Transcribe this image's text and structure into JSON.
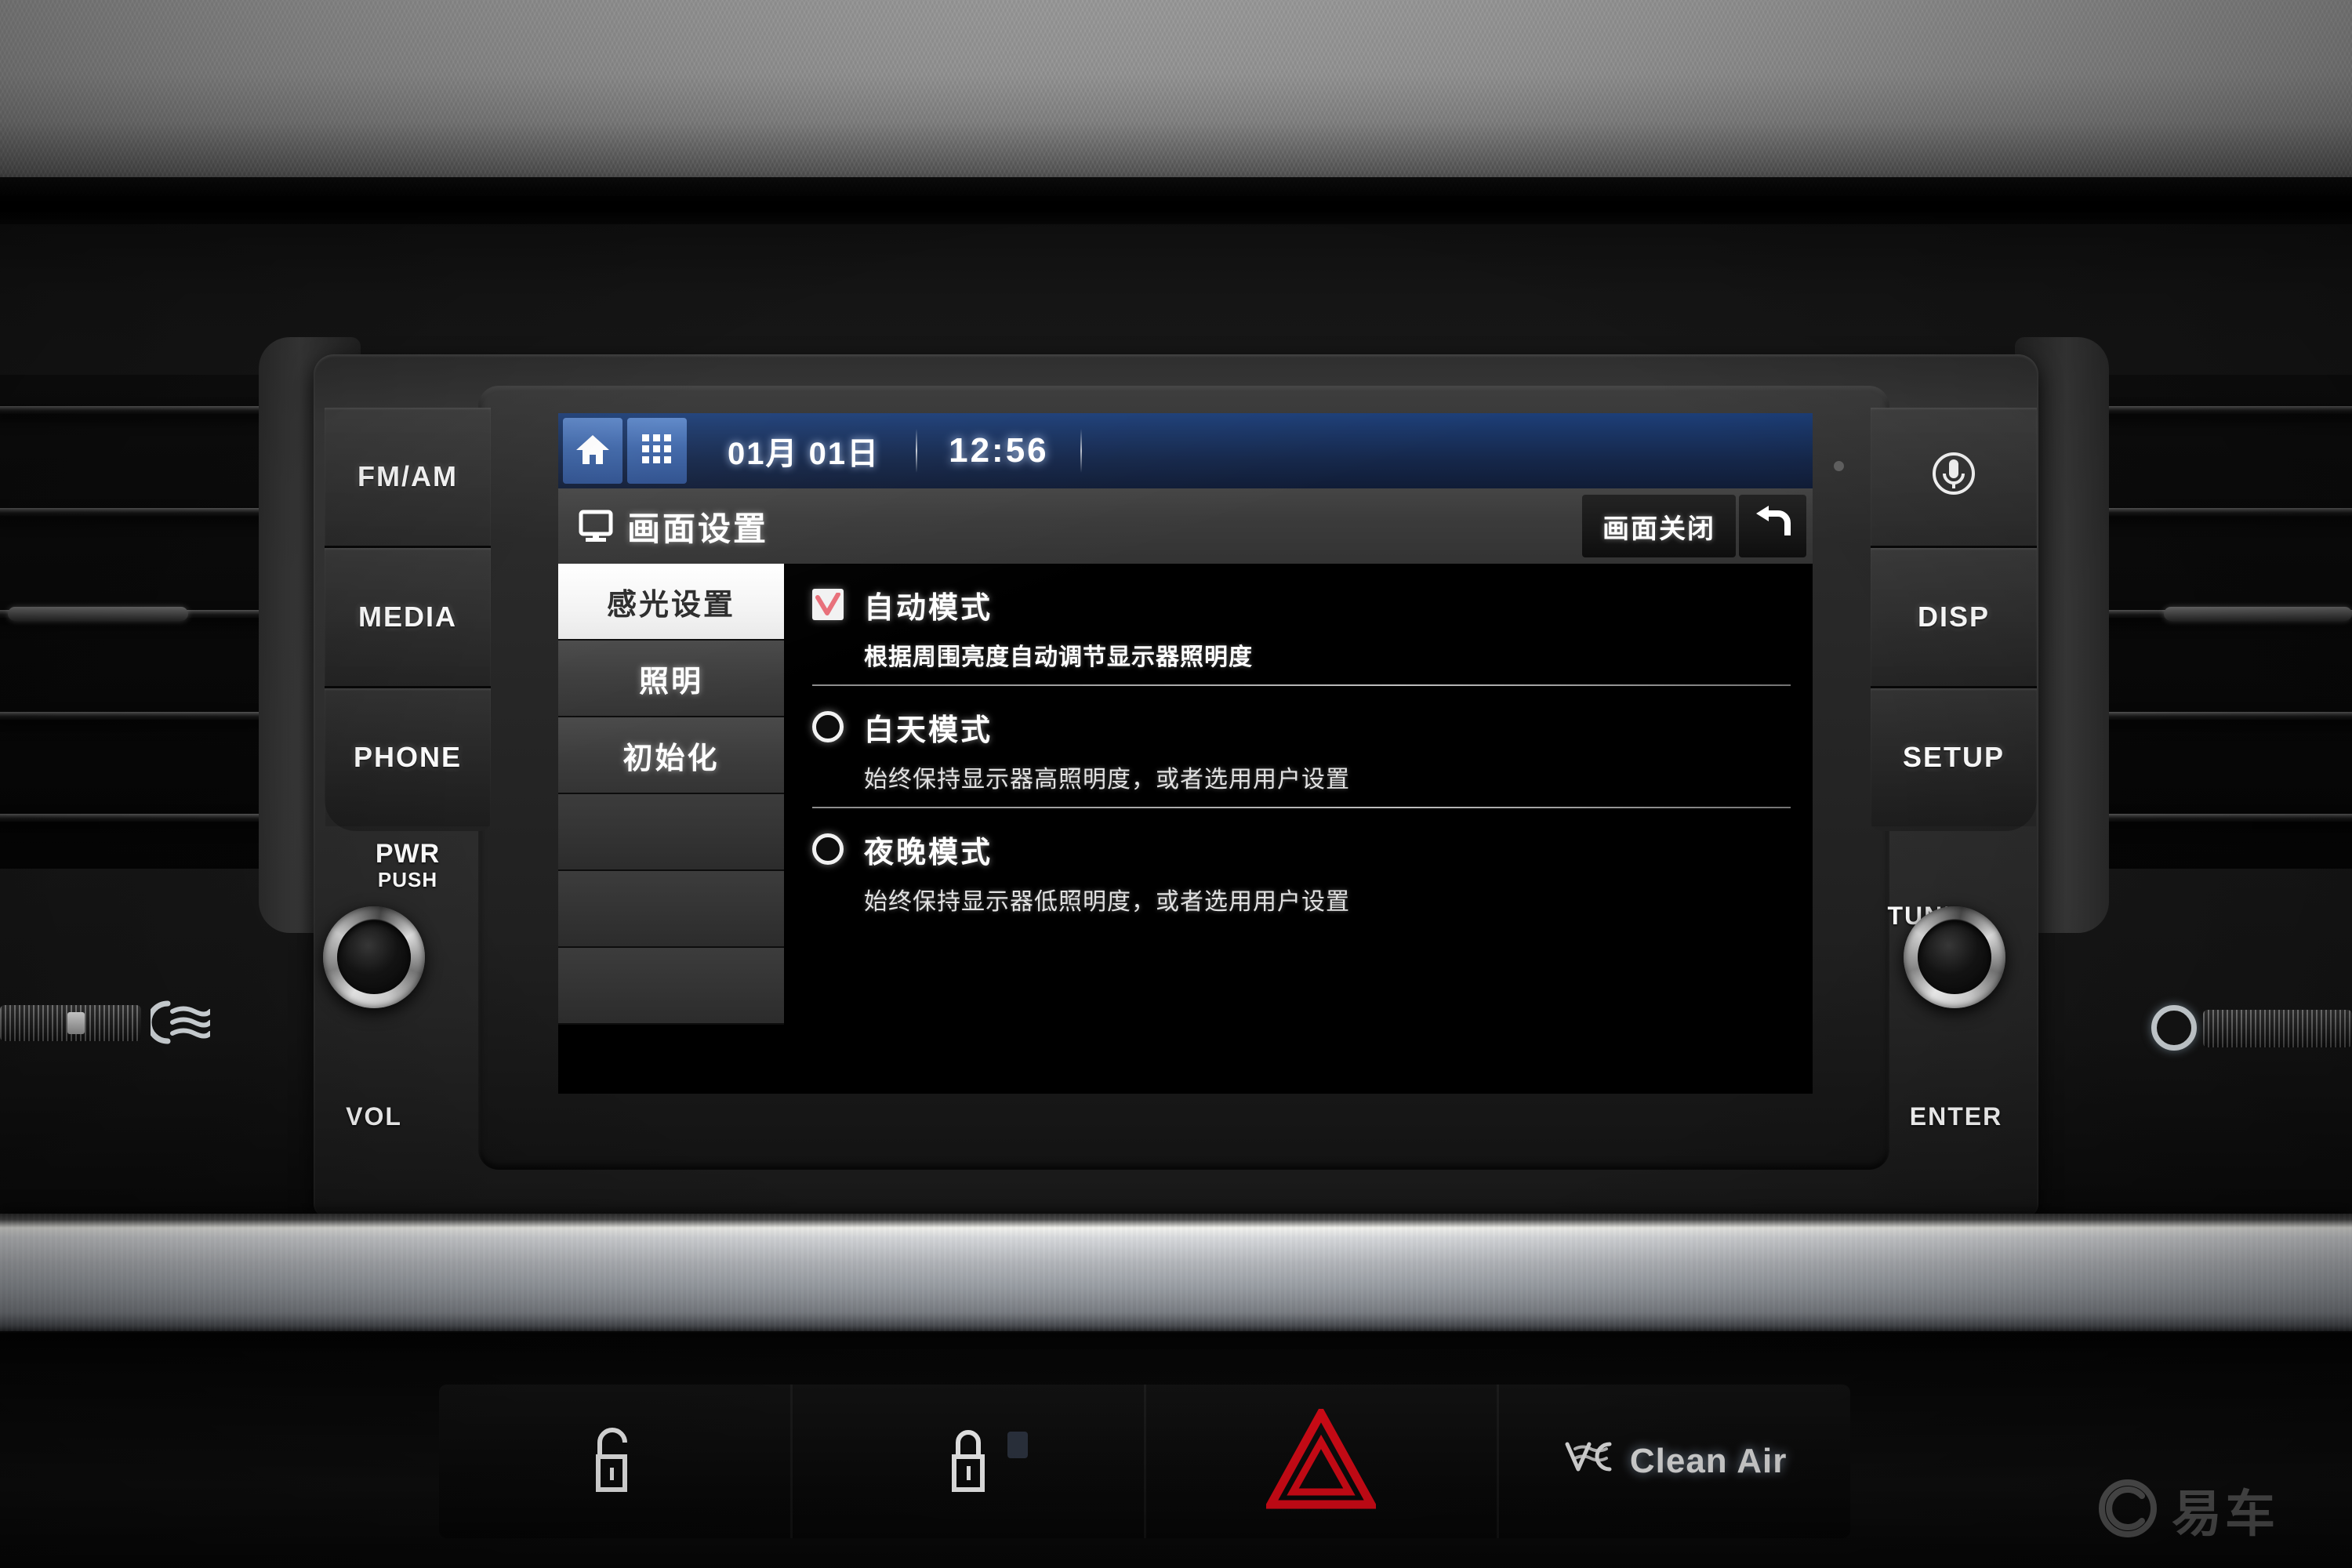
{
  "statusbar": {
    "home_icon": "home-icon",
    "apps_icon": "apps-grid-icon",
    "date": "01月 01日",
    "time": "12:56"
  },
  "titlebar": {
    "icon": "monitor-icon",
    "title": "画面设置",
    "screen_off_label": "画面关闭",
    "back_icon": "back-arrow-icon"
  },
  "tabs": [
    {
      "label": "感光设置",
      "active": true
    },
    {
      "label": "照明",
      "active": false
    },
    {
      "label": "初始化",
      "active": false
    }
  ],
  "options": [
    {
      "control": "checkbox",
      "checked": true,
      "label": "自动模式",
      "desc": "根据周围亮度自动调节显示器照明度"
    },
    {
      "control": "radio",
      "checked": false,
      "label": "白天模式",
      "desc": "始终保持显示器高照明度，或者选用用户设置"
    },
    {
      "control": "radio",
      "checked": false,
      "label": "夜晚模式",
      "desc": "始终保持显示器低照明度，或者选用用户设置"
    }
  ],
  "hard_buttons_left": [
    {
      "label": "FM/AM"
    },
    {
      "label": "MEDIA"
    },
    {
      "label": "PHONE"
    }
  ],
  "hard_buttons_right": [
    {
      "label": "",
      "icon": "microphone-icon"
    },
    {
      "label": "DISP"
    },
    {
      "label": "SETUP"
    }
  ],
  "knobs": {
    "power_line1": "PWR",
    "power_line2": "PUSH",
    "volume_label": "VOL",
    "tune_label": "TUNE",
    "enter_label": "ENTER"
  },
  "lower_panel": [
    {
      "name": "door-unlock",
      "icon": "unlock-icon",
      "label": ""
    },
    {
      "name": "door-lock",
      "icon": "lock-icon",
      "label": ""
    },
    {
      "name": "hazard",
      "icon": "hazard-triangle-icon",
      "label": ""
    },
    {
      "name": "clean-air",
      "icon": "clean-air-icon",
      "label": "Clean Air"
    }
  ],
  "watermark": {
    "text": "易车",
    "icon": "yiche-logo-icon"
  },
  "colors": {
    "accent_blue": "#3e66a8",
    "statusbar_blue": "#1d3f79",
    "check_red": "#e8707a",
    "hazard_red": "#e10b18",
    "selected_tab_bg": "#ffffff"
  }
}
